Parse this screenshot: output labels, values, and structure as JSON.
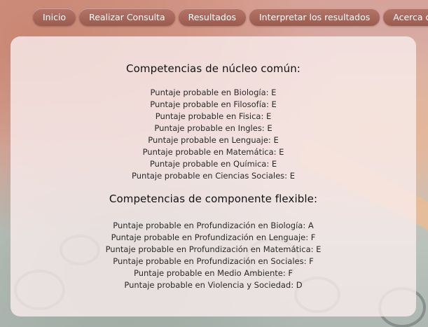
{
  "nav": {
    "items": [
      {
        "label": "Inicio"
      },
      {
        "label": "Realizar Consulta"
      },
      {
        "label": "Resultados"
      },
      {
        "label": "Interpretar los resultados"
      },
      {
        "label": "Acerca de"
      }
    ]
  },
  "results": {
    "core": {
      "title": "Competencias de núcleo común:",
      "lines": [
        "Puntaje probable en Biología: E",
        "Puntaje probable en Filosofía: E",
        "Puntaje probable en Fisica: E",
        "Puntaje probable en Ingles: E",
        "Puntaje probable en Lenguaje: E",
        "Puntaje probable en Matemática: E",
        "Puntaje probable en Química: E",
        "Puntaje probable en Ciencias Sociales: E"
      ]
    },
    "flexible": {
      "title": "Competencias de componente flexible:",
      "lines": [
        "Puntaje probable en Profundización en Biología: A",
        "Puntaje probable en Profundización en Lenguaje: F",
        "Puntaje probable en Profundización en Matemática: E",
        "Puntaje probable en Profundización en Sociales: F",
        "Puntaje probable en Medio Ambiente: F",
        "Puntaje probable en Violencia y Sociedad: D"
      ]
    }
  },
  "colors": {
    "nav_button": "#a8685b",
    "panel": "#f8ecec"
  }
}
